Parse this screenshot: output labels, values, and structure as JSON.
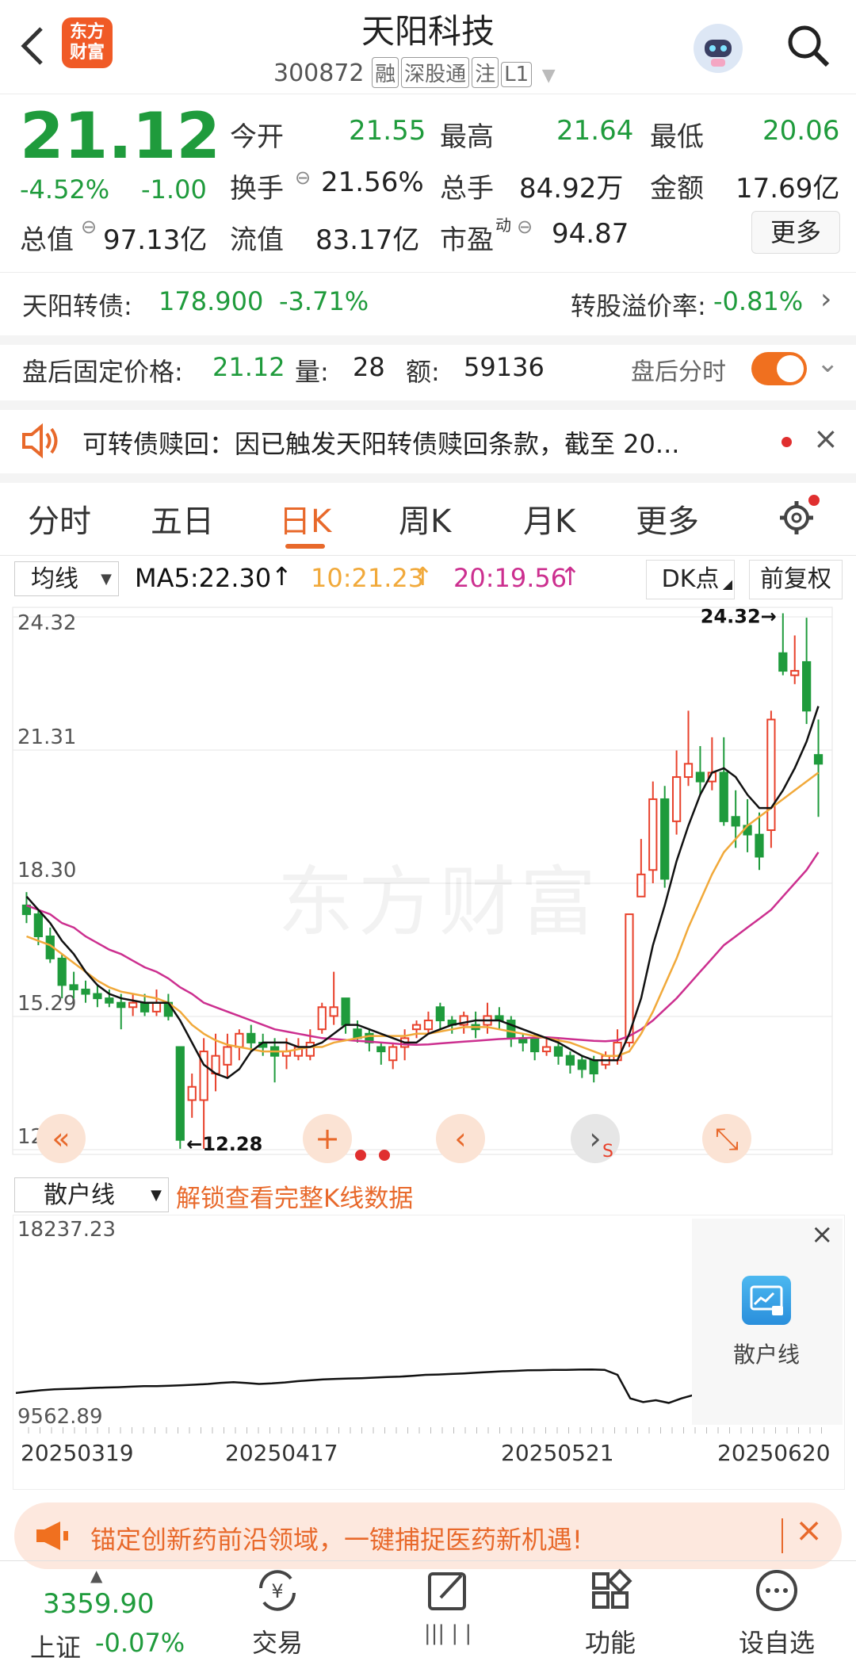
{
  "header": {
    "title": "天阳科技",
    "code": "300872",
    "logo_text": "东方\n财富",
    "tags": [
      "融",
      "深股通",
      "注",
      "L1"
    ]
  },
  "quote": {
    "price": "21.12",
    "pct": "-4.52%",
    "change": "-1.00",
    "stats": [
      {
        "label": "今开",
        "value": "21.55"
      },
      {
        "label": "最高",
        "value": "21.64"
      },
      {
        "label": "最低",
        "value": "20.06"
      },
      {
        "label": "换手",
        "value": "21.56%"
      },
      {
        "label": "总手",
        "value": "84.92万"
      },
      {
        "label": "金额",
        "value": "17.69亿"
      },
      {
        "label": "总值",
        "value": "97.13亿"
      },
      {
        "label": "流值",
        "value": "83.17亿"
      },
      {
        "label": "市盈",
        "value": "94.87",
        "sup": "动"
      }
    ],
    "more_label": "更多"
  },
  "bond": {
    "name": "天阳转债:",
    "price": "178.900",
    "pct": "-3.71%",
    "premium_label": "转股溢价率:",
    "premium": "-0.81%"
  },
  "after_hours": {
    "label": "盘后固定价格:",
    "price": "21.12",
    "vol_label": "量:",
    "vol": "28",
    "amt_label": "额:",
    "amt": "59136",
    "toggle_label": "盘后分时"
  },
  "notice": {
    "text": "可转债赎回：因已触发天阳转债赎回条款，截至 20..."
  },
  "tabs": [
    "分时",
    "五日",
    "日K",
    "周K",
    "月K",
    "更多"
  ],
  "active_tab": "日K",
  "indicators": {
    "select": "均线",
    "ma5": "MA5:22.30",
    "ma10": "10:21.23",
    "ma20": "20:19.56",
    "dk": "DK点",
    "adjust": "前复权"
  },
  "colors": {
    "up": "#e8412b",
    "down": "#1f9b3c",
    "ma5": "#111111",
    "ma10": "#f1a93a",
    "ma20": "#cc2f8f",
    "accent": "#f0701f"
  },
  "chart_data": {
    "type": "candlestick",
    "y_ticks": [
      "24.32",
      "21.31",
      "18.30",
      "15.29",
      "12.28"
    ],
    "ylim": [
      12.28,
      24.32
    ],
    "high_label": "24.32",
    "low_label": "12.28",
    "watermark": "东方财富",
    "candles": [
      [
        17.8,
        17.6,
        18.1,
        17.4
      ],
      [
        17.6,
        17.1,
        17.7,
        16.9
      ],
      [
        17.1,
        16.6,
        17.3,
        16.5
      ],
      [
        16.6,
        16.0,
        16.7,
        15.7
      ],
      [
        16.0,
        15.9,
        16.3,
        15.7
      ],
      [
        15.9,
        15.8,
        16.1,
        15.6
      ],
      [
        15.8,
        15.7,
        16.0,
        15.5
      ],
      [
        15.7,
        15.6,
        15.9,
        15.5
      ],
      [
        15.6,
        15.5,
        15.8,
        15.0
      ],
      [
        15.5,
        15.6,
        15.8,
        15.3
      ],
      [
        15.6,
        15.4,
        15.8,
        15.3
      ],
      [
        15.4,
        15.6,
        15.9,
        15.3
      ],
      [
        15.6,
        15.3,
        15.8,
        15.2
      ],
      [
        14.6,
        12.5,
        14.6,
        12.3
      ],
      [
        13.4,
        13.7,
        14.0,
        13.0
      ],
      [
        13.4,
        14.5,
        14.8,
        12.3
      ],
      [
        14.0,
        14.4,
        14.9,
        13.6
      ],
      [
        14.2,
        14.6,
        14.9,
        13.9
      ],
      [
        14.6,
        14.9,
        15.0,
        14.3
      ],
      [
        14.9,
        14.7,
        15.1,
        14.5
      ],
      [
        14.7,
        14.6,
        14.9,
        14.4
      ],
      [
        14.6,
        14.4,
        14.8,
        13.8
      ],
      [
        14.4,
        14.5,
        14.8,
        14.1
      ],
      [
        14.4,
        14.6,
        14.8,
        14.3
      ],
      [
        14.4,
        14.7,
        15.0,
        14.3
      ],
      [
        15.0,
        15.5,
        15.6,
        14.9
      ],
      [
        15.3,
        15.5,
        16.3,
        15.1
      ],
      [
        15.7,
        15.1,
        15.7,
        14.9
      ],
      [
        15.0,
        14.8,
        15.2,
        14.7
      ],
      [
        14.9,
        14.7,
        15.0,
        14.5
      ],
      [
        14.6,
        14.5,
        14.7,
        14.2
      ],
      [
        14.3,
        14.6,
        14.7,
        14.1
      ],
      [
        14.6,
        14.8,
        15.0,
        14.3
      ],
      [
        15.0,
        15.1,
        15.2,
        14.8
      ],
      [
        15.0,
        15.2,
        15.4,
        14.9
      ],
      [
        15.5,
        15.2,
        15.6,
        15.0
      ],
      [
        15.2,
        15.1,
        15.3,
        14.9
      ],
      [
        15.1,
        15.3,
        15.4,
        14.9
      ],
      [
        15.1,
        15.0,
        15.4,
        14.8
      ],
      [
        15.1,
        15.3,
        15.6,
        14.9
      ],
      [
        15.3,
        15.2,
        15.5,
        15.0
      ],
      [
        15.2,
        14.8,
        15.3,
        14.6
      ],
      [
        14.8,
        14.7,
        14.9,
        14.5
      ],
      [
        14.8,
        14.5,
        14.9,
        14.3
      ],
      [
        14.5,
        14.6,
        14.8,
        14.4
      ],
      [
        14.6,
        14.4,
        14.8,
        14.2
      ],
      [
        14.4,
        14.2,
        14.5,
        14.0
      ],
      [
        14.3,
        14.1,
        14.4,
        13.9
      ],
      [
        14.3,
        14.0,
        14.4,
        13.8
      ],
      [
        14.2,
        14.4,
        14.5,
        14.1
      ],
      [
        14.3,
        14.7,
        15.0,
        14.2
      ],
      [
        14.7,
        17.6,
        17.6,
        14.6
      ],
      [
        18.0,
        18.5,
        19.3,
        18.1
      ],
      [
        18.6,
        20.2,
        20.6,
        18.3
      ],
      [
        20.2,
        18.4,
        20.5,
        18.2
      ],
      [
        19.7,
        20.7,
        21.3,
        19.4
      ],
      [
        20.7,
        21.0,
        22.2,
        20.5
      ],
      [
        20.8,
        20.6,
        21.4,
        20.3
      ],
      [
        20.6,
        20.8,
        21.6,
        20.4
      ],
      [
        20.8,
        19.7,
        21.6,
        19.6
      ],
      [
        19.8,
        19.6,
        20.4,
        19.1
      ],
      [
        19.6,
        19.4,
        20.2,
        19.0
      ],
      [
        19.4,
        18.9,
        19.9,
        18.6
      ],
      [
        19.5,
        22.0,
        22.2,
        19.1
      ],
      [
        23.5,
        23.1,
        24.4,
        23.0
      ],
      [
        23.0,
        23.1,
        23.9,
        22.8
      ],
      [
        23.3,
        22.2,
        24.3,
        21.9
      ],
      [
        21.2,
        21.0,
        22.0,
        19.8
      ]
    ],
    "ma5": [
      18.0,
      17.7,
      17.4,
      17.0,
      16.7,
      16.3,
      16.0,
      15.8,
      15.7,
      15.65,
      15.6,
      15.6,
      15.6,
      15.2,
      14.7,
      14.2,
      14.0,
      13.9,
      14.1,
      14.5,
      14.7,
      14.7,
      14.7,
      14.6,
      14.6,
      14.7,
      14.9,
      15.1,
      15.1,
      15.0,
      14.9,
      14.8,
      14.7,
      14.7,
      14.9,
      15.0,
      15.1,
      15.15,
      15.2,
      15.2,
      15.2,
      15.1,
      15.0,
      14.9,
      14.8,
      14.7,
      14.55,
      14.4,
      14.3,
      14.3,
      14.3,
      14.9,
      15.7,
      16.9,
      17.8,
      18.8,
      19.6,
      20.3,
      20.8,
      20.9,
      20.7,
      20.3,
      20.0,
      20.0,
      20.4,
      20.9,
      21.5,
      22.3
    ],
    "ma10": [
      17.1,
      17.0,
      16.9,
      16.7,
      16.5,
      16.3,
      16.1,
      15.95,
      15.85,
      15.8,
      15.75,
      15.7,
      15.6,
      15.4,
      15.1,
      14.9,
      14.75,
      14.65,
      14.6,
      14.55,
      14.5,
      14.5,
      14.5,
      14.55,
      14.6,
      14.6,
      14.7,
      14.75,
      14.8,
      14.85,
      14.85,
      14.85,
      14.85,
      14.9,
      14.9,
      14.95,
      15.0,
      15.05,
      15.05,
      15.05,
      15.0,
      14.95,
      14.9,
      14.85,
      14.8,
      14.75,
      14.7,
      14.6,
      14.5,
      14.4,
      14.4,
      14.5,
      14.9,
      15.4,
      16.0,
      16.6,
      17.3,
      17.9,
      18.5,
      19.0,
      19.3,
      19.6,
      19.8,
      20.0,
      20.2,
      20.4,
      20.6,
      20.8
    ],
    "ma20": [
      17.8,
      17.7,
      17.6,
      17.4,
      17.3,
      17.1,
      16.95,
      16.8,
      16.7,
      16.55,
      16.4,
      16.3,
      16.15,
      15.95,
      15.8,
      15.6,
      15.5,
      15.4,
      15.3,
      15.2,
      15.1,
      15.0,
      14.95,
      14.9,
      14.85,
      14.8,
      14.78,
      14.76,
      14.74,
      14.72,
      14.7,
      14.68,
      14.66,
      14.65,
      14.66,
      14.68,
      14.7,
      14.72,
      14.74,
      14.76,
      14.78,
      14.79,
      14.8,
      14.81,
      14.82,
      14.8,
      14.78,
      14.76,
      14.74,
      14.73,
      14.75,
      14.85,
      15.0,
      15.2,
      15.45,
      15.7,
      16.0,
      16.3,
      16.6,
      16.9,
      17.1,
      17.3,
      17.5,
      17.7,
      18.0,
      18.3,
      18.6,
      19.0
    ]
  },
  "retail": {
    "select": "散户线",
    "unlock": "解锁查看完整K线数据",
    "ymax": "18237.23",
    "ymin": "9562.89",
    "lock_label": "散户线",
    "dates": [
      "20250319",
      "20250417",
      "20250521",
      "20250620"
    ],
    "line": [
      9700,
      9780,
      9850,
      9900,
      9920,
      9950,
      9980,
      10000,
      10020,
      10050,
      10080,
      10080,
      10100,
      10130,
      10160,
      10200,
      10260,
      10300,
      10250,
      10200,
      10230,
      10280,
      10350,
      10400,
      10450,
      10480,
      10500,
      10520,
      10550,
      10580,
      10600,
      10650,
      10700,
      10720,
      10750,
      10780,
      10820,
      10860,
      10900,
      10920,
      10950,
      10960,
      10980,
      10980,
      10990,
      11000,
      10980,
      10700,
      9400,
      9200,
      9300,
      9150,
      9400,
      9600
    ]
  },
  "banner": {
    "text": "锚定创新药前沿领域，一键捕捉医药新机遇!"
  },
  "bottom_nav": {
    "index_value": "3359.90",
    "index_name": "上证",
    "index_pct": "-0.07%",
    "items": [
      "交易",
      "功能",
      "设自选"
    ]
  }
}
